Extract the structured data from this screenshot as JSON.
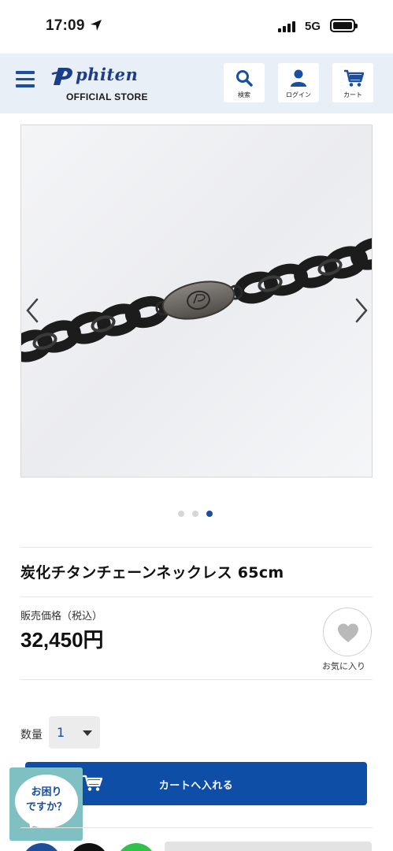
{
  "status_bar": {
    "time": "17:09",
    "network": "5G"
  },
  "header": {
    "logo_text": "phiten",
    "store_label": "OFFICIAL STORE",
    "search_label": "検索",
    "login_label": "ログイン",
    "cart_label": "カート"
  },
  "gallery": {
    "slide_count": 3,
    "active_index": 2
  },
  "product": {
    "title": "炭化チタンチェーンネックレス 65cm",
    "price_label": "販売価格（税込）",
    "price": "32,450円",
    "favorite_label": "お気に入り"
  },
  "purchase": {
    "quantity_label": "数量",
    "quantity_value": "1",
    "add_to_cart_label": "カートへ入れる"
  },
  "help": {
    "line1": "お困り",
    "line2": "ですか？"
  },
  "colors": {
    "brand_blue": "#0f4ea6",
    "header_bg": "#e8eff7",
    "help_teal": "#7fc1c3"
  }
}
